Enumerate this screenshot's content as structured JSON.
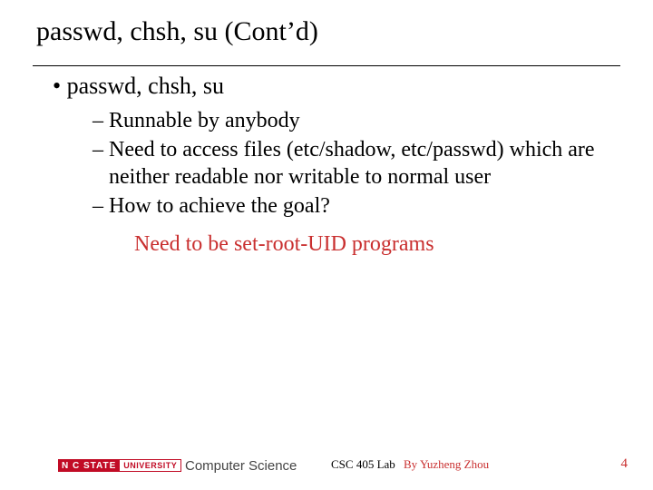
{
  "title": "passwd, chsh, su (Cont’d)",
  "bullets": {
    "l1": "passwd, chsh, su",
    "sub": [
      "Runnable by anybody",
      "Need to access files (etc/shadow, etc/passwd) which are neither readable nor writable to normal user",
      "How to achieve the goal?"
    ],
    "answer": "Need to be set-root-UID programs"
  },
  "footer": {
    "logo_red": "N C STATE",
    "logo_white": "UNIVERSITY",
    "dept": "Computer Science",
    "course": "CSC 405 Lab",
    "author": "By Yuzheng Zhou",
    "page": "4"
  }
}
